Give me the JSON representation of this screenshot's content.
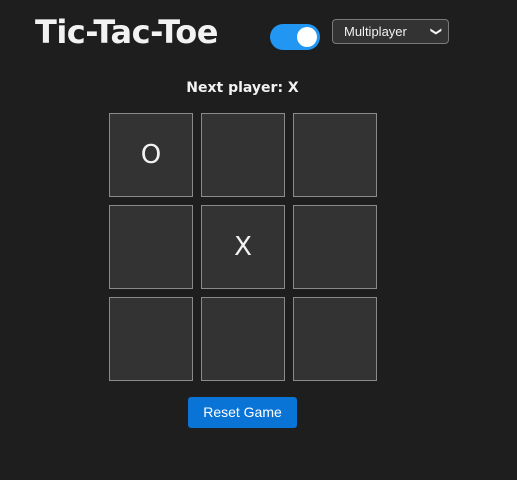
{
  "header": {
    "title": "Tic-Tac-Toe"
  },
  "controls": {
    "toggle_on": true,
    "mode_options": [
      "Multiplayer"
    ],
    "mode_selected": "Multiplayer"
  },
  "game": {
    "status_text": "Next player: X",
    "cells": [
      "O",
      "",
      "",
      "",
      "X",
      "",
      "",
      "",
      ""
    ]
  },
  "actions": {
    "reset_label": "Reset Game"
  },
  "colors": {
    "background": "#1e1e1e",
    "cell_background": "#333333",
    "toggle_on": "#2196f3",
    "reset_button": "#0a74d6"
  },
  "icons": {
    "mode_select_chevron": "chevron-down-icon"
  }
}
